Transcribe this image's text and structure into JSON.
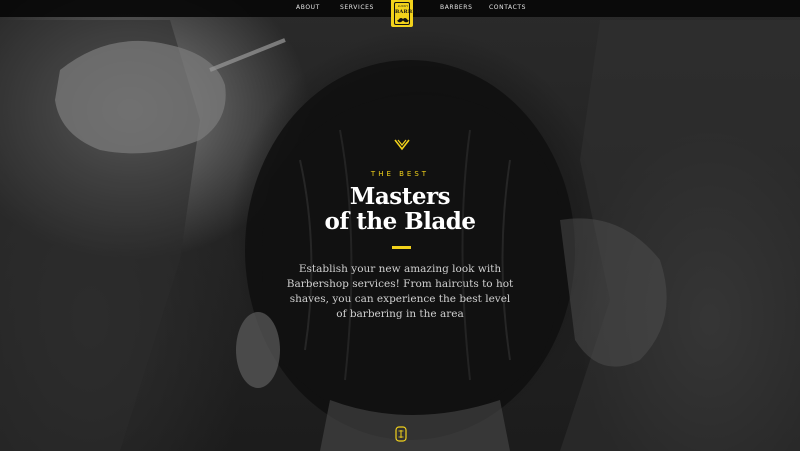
{
  "nav": {
    "items": [
      {
        "label": "ABOUT"
      },
      {
        "label": "SERVICES"
      },
      {
        "label": "BARBERS"
      },
      {
        "label": "CONTACTS"
      }
    ]
  },
  "logo": {
    "top_text": "LUCKY",
    "word": "BARBER",
    "icon": "mustache-icon"
  },
  "hero": {
    "eyebrow": "THE BEST",
    "headline_line1": "Masters",
    "headline_line2": "of the Blade",
    "description": "Establish your new amazing look with Barbershop services! From haircuts to hot shaves, you can experience the best level of barbering in the area",
    "top_icon": "chevron-down-icon",
    "bottom_icon": "scroll-badge-icon"
  },
  "colors": {
    "accent": "#f2d21b",
    "nav_bg": "#080808",
    "text": "#ffffff"
  }
}
